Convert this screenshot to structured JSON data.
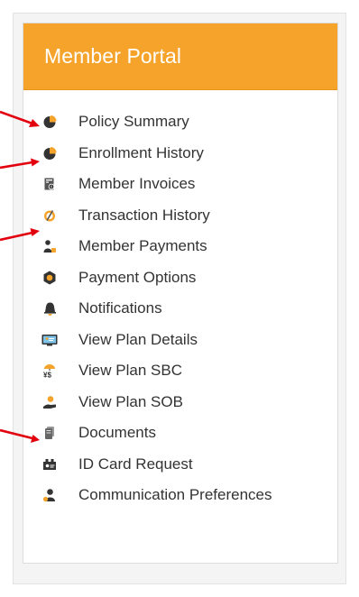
{
  "portal": {
    "title": "Member Portal",
    "header_color": "#f5a32a",
    "items": [
      {
        "label": "Policy Summary",
        "icon": "pie-chart-icon"
      },
      {
        "label": "Enrollment History",
        "icon": "pie-chart-icon"
      },
      {
        "label": "Member Invoices",
        "icon": "invoice-icon"
      },
      {
        "label": "Transaction History",
        "icon": "transaction-icon"
      },
      {
        "label": "Member Payments",
        "icon": "payment-user-icon"
      },
      {
        "label": "Payment Options",
        "icon": "gear-icon"
      },
      {
        "label": "Notifications",
        "icon": "bell-icon"
      },
      {
        "label": "View Plan Details",
        "icon": "monitor-icon"
      },
      {
        "label": "View Plan SBC",
        "icon": "plan-sbc-icon"
      },
      {
        "label": "View Plan SOB",
        "icon": "user-hand-icon"
      },
      {
        "label": "Documents",
        "icon": "documents-icon"
      },
      {
        "label": "ID Card Request",
        "icon": "id-card-icon"
      },
      {
        "label": "Communication Preferences",
        "icon": "user-preferences-icon"
      }
    ]
  },
  "annotations": {
    "arrow_color": "#e2000f"
  }
}
